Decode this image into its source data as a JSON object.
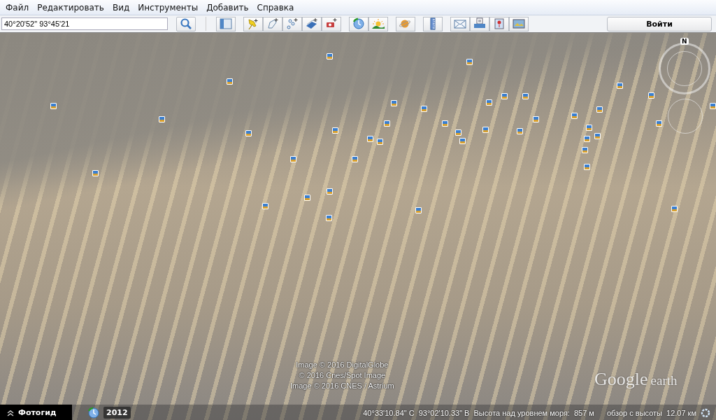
{
  "menu": [
    {
      "label": "Файл"
    },
    {
      "label": "Редактировать"
    },
    {
      "label": "Вид"
    },
    {
      "label": "Инструменты"
    },
    {
      "label": "Добавить"
    },
    {
      "label": "Справка"
    }
  ],
  "search": {
    "value": "40°20'52\" 93°45'21"
  },
  "login_button": {
    "label": "Войти"
  },
  "map": {
    "compass": {
      "north": "N"
    },
    "credits": [
      "Image © 2016 DigitalGlobe",
      "© 2016 Cnes/Spot Image",
      "Image © 2016 CNES / Astrium"
    ],
    "logo": {
      "word_1": "Google",
      "word_2": "earth"
    }
  },
  "status_bar": {
    "photo_guide": {
      "label": "Фотогид",
      "expanded": false
    },
    "year": "2012",
    "latitude": "40°33'10.84\" С",
    "longitude": "93°02'10.33\" В",
    "elevation_label": "Высота над уровнем моря:",
    "elevation": "857 м",
    "eye_alt_label": "обзор с высоты",
    "eye_alt": "12.07 км"
  }
}
